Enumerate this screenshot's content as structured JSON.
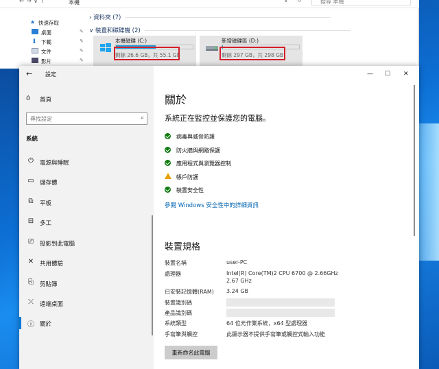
{
  "explorer": {
    "path": "本機",
    "search_placeholder": "搜尋 本機",
    "quick_access": "快速存取",
    "nav_items": [
      "桌面",
      "下載",
      "文件",
      "影片"
    ],
    "folders_header": "資料夾 (7)",
    "devices_header": "裝置和磁碟機 (2)",
    "drives": [
      {
        "name": "本機磁碟 (C:)",
        "space": "剩餘 26.6 GB，共 55.1 GB",
        "used_fraction": 0.52
      },
      {
        "name": "新增磁碟區 (D:)",
        "space": "剩餘 297 GB，共 298 GB",
        "used_fraction": 0.01
      }
    ]
  },
  "settings": {
    "window_title": "設定",
    "home_label": "首頁",
    "search_placeholder": "尋找設定",
    "category": "系統",
    "nav_items": [
      {
        "label": "電源與睡眠",
        "icon": "power-icon"
      },
      {
        "label": "儲存體",
        "icon": "storage-icon"
      },
      {
        "label": "平板",
        "icon": "tablet-icon"
      },
      {
        "label": "多工",
        "icon": "multitasking-icon"
      },
      {
        "label": "投影到此電腦",
        "icon": "projecting-icon"
      },
      {
        "label": "共用體驗",
        "icon": "shared-experiences-icon"
      },
      {
        "label": "剪貼簿",
        "icon": "clipboard-icon"
      },
      {
        "label": "遠端桌面",
        "icon": "remote-desktop-icon"
      },
      {
        "label": "關於",
        "icon": "info-icon"
      }
    ],
    "window_controls": {
      "minimize": "—",
      "maximize": "☐",
      "close": "✕"
    },
    "about": {
      "title": "關於",
      "subtitle": "系統正在監控並保護您的電腦。",
      "protections": [
        {
          "label": "病毒與威脅防護",
          "status": "ok"
        },
        {
          "label": "防火牆與網路保護",
          "status": "ok"
        },
        {
          "label": "應用程式與瀏覽器控制",
          "status": "ok"
        },
        {
          "label": "帳戶防護",
          "status": "warning"
        },
        {
          "label": "裝置安全性",
          "status": "ok"
        }
      ],
      "details_link": "參閱 Windows 安全性中的詳細資訊",
      "specs_title": "裝置規格",
      "specs": [
        {
          "key": "裝置名稱",
          "value": "user-PC"
        },
        {
          "key": "處理器",
          "value": "Intel(R) Core(TM)2 CPU        6700  @ 2.66GHz",
          "value2": "2.67 GHz"
        },
        {
          "key": "已安裝記憶體(RAM)",
          "value": "3.24 GB"
        },
        {
          "key": "裝置識別碼",
          "value": "",
          "redacted": true
        },
        {
          "key": "產品識別碼",
          "value": "",
          "redacted": true
        },
        {
          "key": "系統類型",
          "value": "64 位元作業系統，x64 型處理器"
        },
        {
          "key": "手寫筆與觸控",
          "value": "此顯示器不提供手寫筆或觸控式輸入功能"
        }
      ],
      "rename_button": "重新命名此電腦"
    }
  }
}
